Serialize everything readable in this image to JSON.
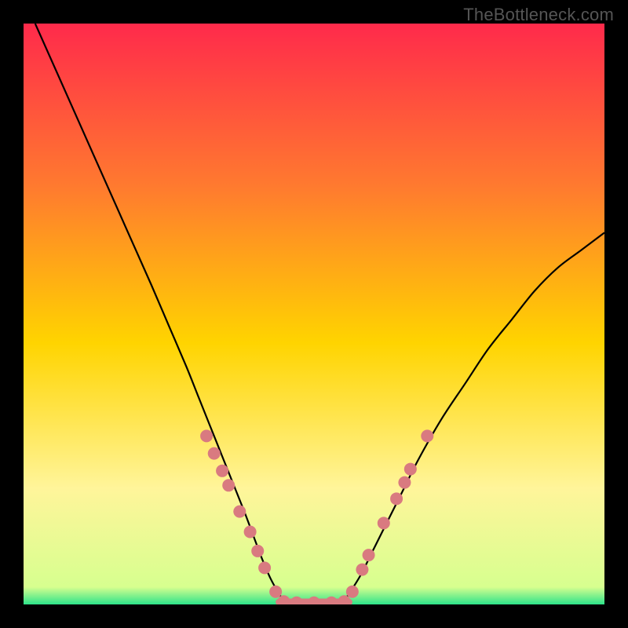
{
  "watermark": "TheBottleneck.com",
  "chart_data": {
    "type": "line",
    "title": "",
    "xlabel": "",
    "ylabel": "",
    "xlim": [
      0,
      100
    ],
    "ylim": [
      0,
      100
    ],
    "background_gradient": {
      "top": "#ff2a4b",
      "q1": "#ff7a2f",
      "mid": "#ffd400",
      "q3": "#fff59a",
      "bottom": "#2de38a"
    },
    "series": [
      {
        "name": "left-arc",
        "stroke": "#000000",
        "x": [
          2,
          6,
          10,
          14,
          18,
          22,
          25,
          28,
          30,
          32,
          34,
          36,
          38,
          39.5,
          41,
          42.5,
          44,
          45
        ],
        "y": [
          100,
          91,
          82,
          73,
          64,
          55,
          48,
          41,
          36,
          31,
          26,
          21,
          16,
          12,
          8,
          4.5,
          1.8,
          0.4
        ]
      },
      {
        "name": "right-arc",
        "stroke": "#000000",
        "x": [
          55,
          56,
          58,
          60,
          62,
          65,
          68,
          72,
          76,
          80,
          84,
          88,
          92,
          96,
          100
        ],
        "y": [
          0.4,
          1.8,
          5,
          9,
          13,
          19,
          25,
          32,
          38,
          44,
          49,
          54,
          58,
          61,
          64
        ]
      },
      {
        "name": "baseline-link",
        "stroke": "#d97a80",
        "stroke_width": 9,
        "x": [
          44,
          56
        ],
        "y": [
          0.4,
          0.4
        ]
      }
    ],
    "marker_points": {
      "color": "#d97a80",
      "radius": 8,
      "points": [
        {
          "x": 31.5,
          "y": 29
        },
        {
          "x": 32.8,
          "y": 26
        },
        {
          "x": 34.2,
          "y": 23
        },
        {
          "x": 35.3,
          "y": 20.5
        },
        {
          "x": 37.2,
          "y": 16
        },
        {
          "x": 39.0,
          "y": 12.5
        },
        {
          "x": 40.3,
          "y": 9.2
        },
        {
          "x": 41.5,
          "y": 6.3
        },
        {
          "x": 43.4,
          "y": 2.2
        },
        {
          "x": 44.8,
          "y": 0.5
        },
        {
          "x": 47.0,
          "y": 0.3
        },
        {
          "x": 50.0,
          "y": 0.3
        },
        {
          "x": 53.0,
          "y": 0.3
        },
        {
          "x": 55.2,
          "y": 0.5
        },
        {
          "x": 56.6,
          "y": 2.2
        },
        {
          "x": 58.3,
          "y": 6.0
        },
        {
          "x": 59.4,
          "y": 8.5
        },
        {
          "x": 62.0,
          "y": 14.0
        },
        {
          "x": 64.2,
          "y": 18.2
        },
        {
          "x": 65.6,
          "y": 21.0
        },
        {
          "x": 66.6,
          "y": 23.3
        },
        {
          "x": 69.5,
          "y": 29.0
        }
      ]
    }
  }
}
